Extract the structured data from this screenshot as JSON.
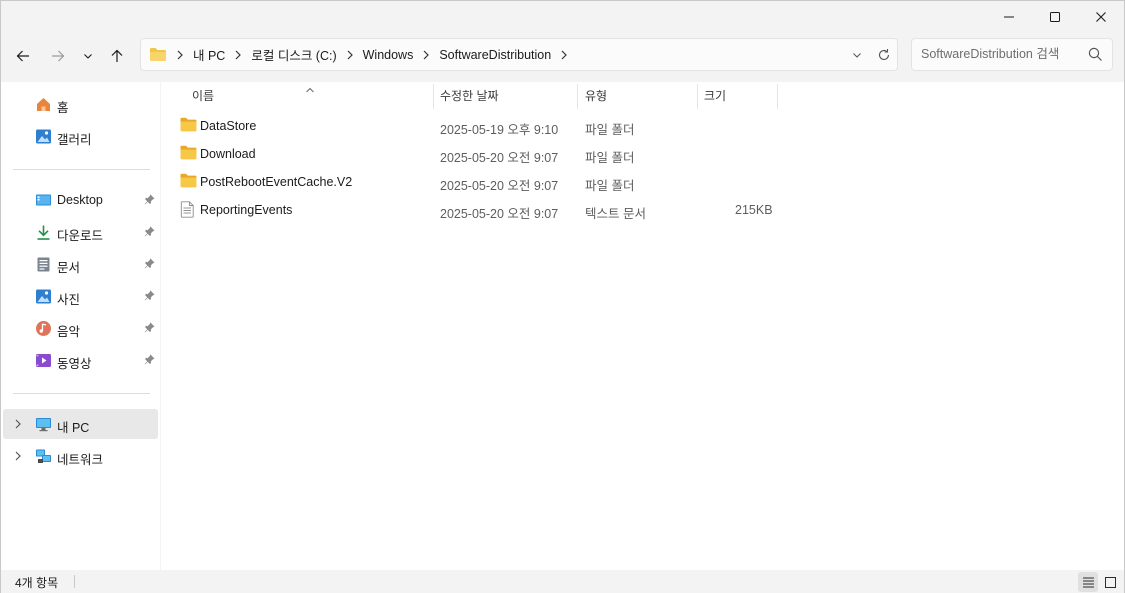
{
  "window": {
    "minimize_icon": "minimize-icon",
    "maximize_icon": "maximize-icon",
    "close_icon": "close-icon"
  },
  "nav": {
    "back_icon": "arrow-left-icon",
    "forward_icon": "arrow-right-icon",
    "recent_icon": "chevron-down-icon",
    "up_icon": "arrow-up-icon"
  },
  "address": {
    "breadcrumbs": [
      "내 PC",
      "로컬 디스크 (C:)",
      "Windows",
      "SoftwareDistribution"
    ]
  },
  "search": {
    "placeholder": "SoftwareDistribution 검색"
  },
  "sidebar": {
    "home": "홈",
    "gallery": "갤러리",
    "pinned": [
      {
        "label": "Desktop",
        "icon": "desktop-icon"
      },
      {
        "label": "다운로드",
        "icon": "download-icon"
      },
      {
        "label": "문서",
        "icon": "document-icon"
      },
      {
        "label": "사진",
        "icon": "pictures-icon"
      },
      {
        "label": "음악",
        "icon": "music-icon"
      },
      {
        "label": "동영상",
        "icon": "video-icon"
      }
    ],
    "this_pc": "내 PC",
    "network": "네트워크"
  },
  "columns": {
    "name": "이름",
    "modified": "수정한 날짜",
    "type": "유형",
    "size": "크기"
  },
  "files": [
    {
      "name": "DataStore",
      "modified": "2025-05-19 오후 9:10",
      "type": "파일 폴더",
      "size": "",
      "icon": "folder-icon"
    },
    {
      "name": "Download",
      "modified": "2025-05-20 오전 9:07",
      "type": "파일 폴더",
      "size": "",
      "icon": "folder-icon"
    },
    {
      "name": "PostRebootEventCache.V2",
      "modified": "2025-05-20 오전 9:07",
      "type": "파일 폴더",
      "size": "",
      "icon": "folder-icon"
    },
    {
      "name": "ReportingEvents",
      "modified": "2025-05-20 오전 9:07",
      "type": "텍스트 문서",
      "size": "215KB",
      "icon": "text-file-icon"
    }
  ],
  "status": {
    "item_count": "4개 항목"
  },
  "colors": {
    "folder": "#f4c542",
    "accent": "#0067c0"
  }
}
